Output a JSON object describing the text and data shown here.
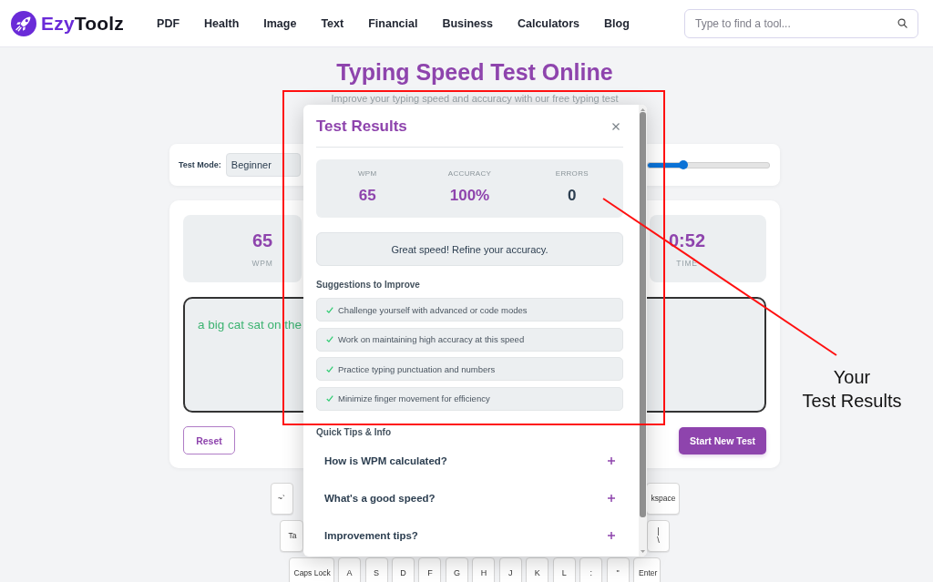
{
  "header": {
    "logo": {
      "accent": "Ezy",
      "rest": "Toolz"
    },
    "nav": [
      {
        "label": "PDF"
      },
      {
        "label": "Health"
      },
      {
        "label": "Image"
      },
      {
        "label": "Text"
      },
      {
        "label": "Financial"
      },
      {
        "label": "Business"
      },
      {
        "label": "Calculators"
      },
      {
        "label": "Blog"
      }
    ],
    "search": {
      "placeholder": "Type to find a tool..."
    }
  },
  "intro": {
    "title": "Typing Speed Test Online",
    "subtitle": "Improve your typing speed and accuracy with our free typing test"
  },
  "settings": {
    "test_mode_label": "Test Mode:",
    "test_mode": "Beginner",
    "slider": {
      "level": 0.29
    }
  },
  "test": {
    "stats": [
      {
        "value": "65",
        "label": "WPM"
      },
      {
        "value": "0:52",
        "label": "TIME"
      }
    ],
    "typed_text": "a big cat sat on the",
    "buttons": [
      {
        "label": "Reset",
        "kind": "secondary"
      },
      {
        "label": "Start New Test",
        "kind": "primary"
      }
    ]
  },
  "keyboard": {
    "rows": [
      [
        {
          "label": "~`",
          "kind": "char"
        },
        {
          "label": "kspace",
          "kind": "function"
        }
      ],
      [
        {
          "label": "Ta",
          "kind": "function"
        },
        {
          "label": "\\",
          "shift": "|",
          "kind": "char"
        }
      ],
      [
        {
          "label": "Caps Lock",
          "kind": "function"
        },
        {
          "label": "A",
          "kind": "char"
        },
        {
          "label": "S",
          "kind": "char"
        },
        {
          "label": "D",
          "kind": "char"
        },
        {
          "label": "F",
          "kind": "char"
        },
        {
          "label": "G",
          "kind": "char"
        },
        {
          "label": "H",
          "kind": "char"
        },
        {
          "label": "J",
          "kind": "char"
        },
        {
          "label": "K",
          "kind": "char"
        },
        {
          "label": "L",
          "kind": "char"
        },
        {
          "label": ":",
          "kind": "char"
        },
        {
          "label": "\"",
          "kind": "char"
        },
        {
          "label": "Enter",
          "kind": "function"
        }
      ]
    ]
  },
  "results_dialog": {
    "title": "Test Results",
    "stats": [
      {
        "label": "WPM",
        "value": "65",
        "color": "#8e44ad"
      },
      {
        "label": "ACCURACY",
        "value": "100%",
        "color": "#8e44ad"
      },
      {
        "label": "ERRORS",
        "value": "0",
        "color": "#2c3e50"
      }
    ],
    "message": "Great speed! Refine your accuracy.",
    "suggestions_heading": "Suggestions to Improve",
    "suggestions": [
      "Challenge yourself with advanced or code modes",
      "Work on maintaining high accuracy at this speed",
      "Practice typing punctuation and numbers",
      "Minimize finger movement for efficiency"
    ],
    "tips_heading": "Quick Tips & Info",
    "tips": [
      {
        "question": "How is WPM calculated?",
        "expanded": false
      },
      {
        "question": "What's a good speed?",
        "expanded": false
      },
      {
        "question": "Improvement tips?",
        "expanded": false
      }
    ]
  },
  "annotation": {
    "lines": [
      "Your",
      "Test Results"
    ]
  }
}
